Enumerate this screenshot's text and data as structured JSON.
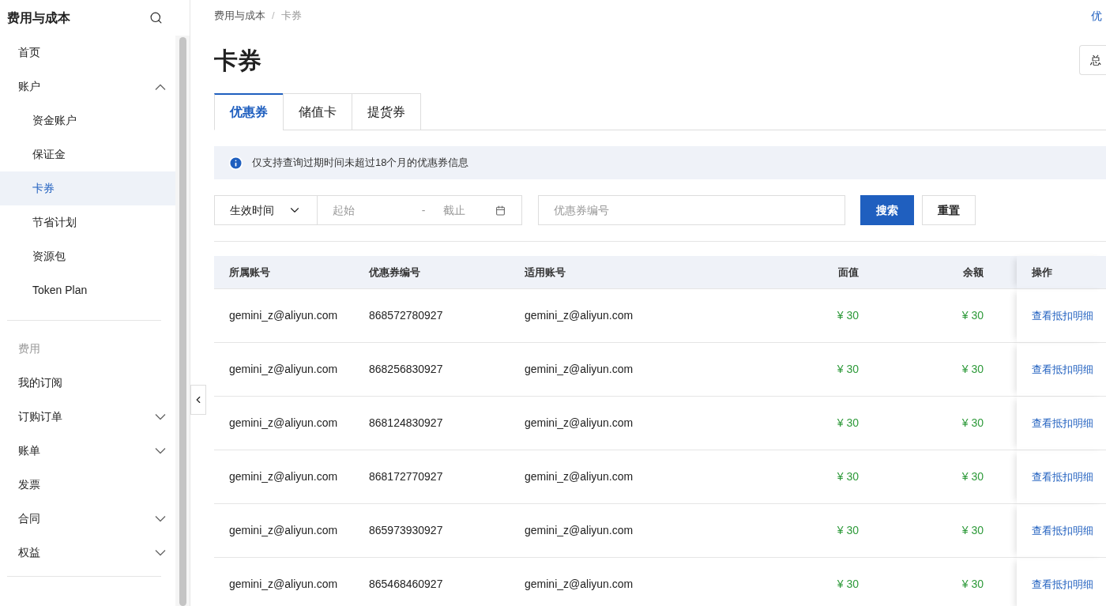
{
  "sidebar": {
    "title": "费用与成本",
    "groups": [
      {
        "items": [
          {
            "label": "首页",
            "selected": false
          },
          {
            "label": "账户",
            "selected": false,
            "expanded": true,
            "children": [
              {
                "label": "资金账户",
                "selected": false
              },
              {
                "label": "保证金",
                "selected": false
              },
              {
                "label": "卡券",
                "selected": true
              },
              {
                "label": "节省计划",
                "selected": false
              },
              {
                "label": "资源包",
                "selected": false
              },
              {
                "label": "Token Plan",
                "selected": false
              }
            ]
          }
        ]
      },
      {
        "heading": "费用",
        "items": [
          {
            "label": "我的订阅",
            "selected": false
          },
          {
            "label": "订购订单",
            "selected": false,
            "expanded": false
          },
          {
            "label": "账单",
            "selected": false,
            "expanded": false
          },
          {
            "label": "发票",
            "selected": false
          },
          {
            "label": "合同",
            "selected": false,
            "expanded": false
          },
          {
            "label": "权益",
            "selected": false,
            "expanded": false
          }
        ]
      }
    ]
  },
  "breadcrumb": [
    "费用与成本",
    "卡券"
  ],
  "breadcrumb_separator": "/",
  "top_link": "优",
  "page_title": "卡券",
  "header_button": "总",
  "tabs": [
    {
      "label": "优惠券",
      "selected": true
    },
    {
      "label": "储值卡",
      "selected": false
    },
    {
      "label": "提货券",
      "selected": false
    }
  ],
  "notice": "仅支持查询过期时间未超过18个月的优惠券信息",
  "filters": {
    "time_type": "生效时间",
    "start_placeholder": "起始",
    "range_separator": "-",
    "end_placeholder": "截止",
    "code_placeholder": "优惠券编号",
    "search_button": "搜索",
    "reset_button": "重置"
  },
  "table": {
    "columns": [
      "所属账号",
      "优惠券编号",
      "适用账号",
      "面值",
      "余额",
      "操作"
    ],
    "rows": [
      {
        "owner": "gemini_z@aliyun.com",
        "code": "868572780927",
        "account": "gemini_z@aliyun.com",
        "face_value": "¥ 30",
        "balance": "¥ 30",
        "action": "查看抵扣明细"
      },
      {
        "owner": "gemini_z@aliyun.com",
        "code": "868256830927",
        "account": "gemini_z@aliyun.com",
        "face_value": "¥ 30",
        "balance": "¥ 30",
        "action": "查看抵扣明细"
      },
      {
        "owner": "gemini_z@aliyun.com",
        "code": "868124830927",
        "account": "gemini_z@aliyun.com",
        "face_value": "¥ 30",
        "balance": "¥ 30",
        "action": "查看抵扣明细"
      },
      {
        "owner": "gemini_z@aliyun.com",
        "code": "868172770927",
        "account": "gemini_z@aliyun.com",
        "face_value": "¥ 30",
        "balance": "¥ 30",
        "action": "查看抵扣明细"
      },
      {
        "owner": "gemini_z@aliyun.com",
        "code": "865973930927",
        "account": "gemini_z@aliyun.com",
        "face_value": "¥ 30",
        "balance": "¥ 30",
        "action": "查看抵扣明细"
      },
      {
        "owner": "gemini_z@aliyun.com",
        "code": "865468460927",
        "account": "gemini_z@aliyun.com",
        "face_value": "¥ 30",
        "balance": "¥ 30",
        "action": "查看抵扣明细"
      }
    ]
  }
}
